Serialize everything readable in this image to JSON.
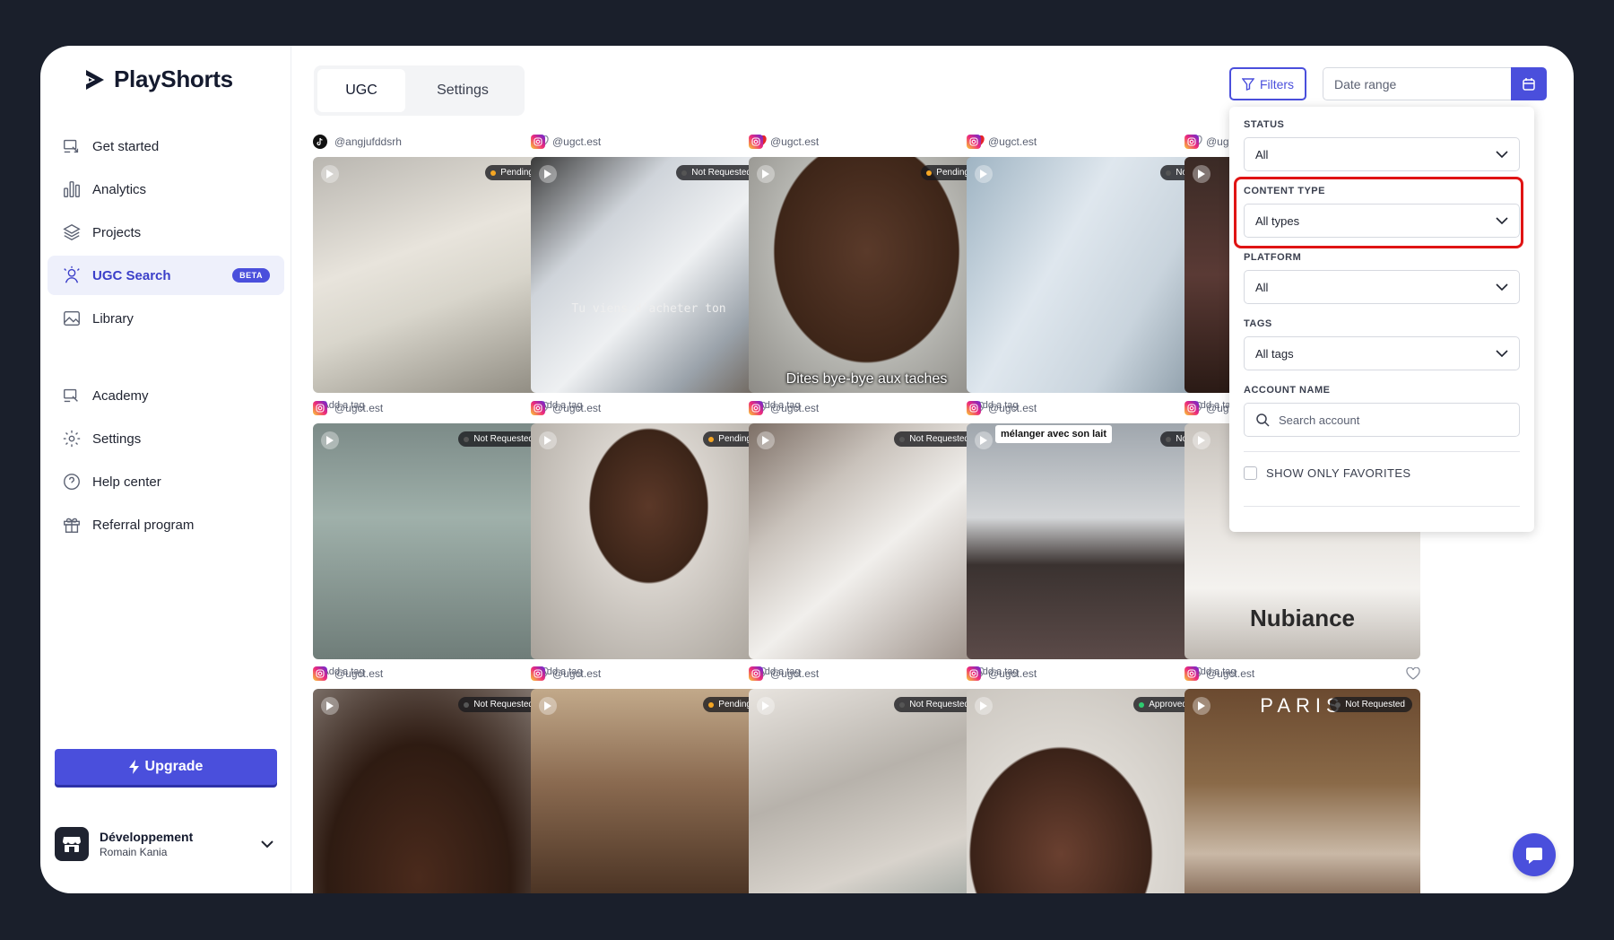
{
  "app": {
    "name": "PlayShorts"
  },
  "sidebar": {
    "items": [
      {
        "label": "Get started",
        "icon": "rocket-icon"
      },
      {
        "label": "Analytics",
        "icon": "bar-chart-icon"
      },
      {
        "label": "Projects",
        "icon": "layers-icon"
      },
      {
        "label": "UGC Search",
        "icon": "ugc-search-icon",
        "active": true,
        "badge": "BETA"
      },
      {
        "label": "Library",
        "icon": "image-icon"
      },
      {
        "label": "Academy",
        "icon": "academy-icon"
      },
      {
        "label": "Settings",
        "icon": "gear-icon"
      },
      {
        "label": "Help center",
        "icon": "help-circle-icon"
      },
      {
        "label": "Referral program",
        "icon": "gift-icon"
      }
    ],
    "upgrade_label": "Upgrade",
    "account": {
      "workspace": "Développement",
      "user": "Romain Kania"
    }
  },
  "tabs": [
    {
      "label": "UGC",
      "active": true
    },
    {
      "label": "Settings",
      "active": false
    }
  ],
  "toolbar": {
    "filters_label": "Filters",
    "date_range_placeholder": "Date range"
  },
  "filters": {
    "status": {
      "label": "STATUS",
      "value": "All"
    },
    "content_type": {
      "label": "CONTENT TYPE",
      "value": "All types"
    },
    "platform": {
      "label": "PLATFORM",
      "value": "All"
    },
    "tags": {
      "label": "TAGS",
      "value": "All tags"
    },
    "account_name": {
      "label": "ACCOUNT NAME",
      "placeholder": "Search account"
    },
    "favorites_label": "SHOW ONLY FAVORITES"
  },
  "add_tag_label": "Add a tag",
  "colors": {
    "accent": "#4a4fdc",
    "pending": "#f5a623",
    "not_requested": "#555555",
    "approved": "#2ecc71",
    "favorite": "#e5252a",
    "highlight": "#e01414"
  },
  "cards": [
    {
      "platform": "tiktok",
      "handle": "@angjufddsrh",
      "status": "Pending",
      "favorite": false,
      "bg": "bottle",
      "caption": ""
    },
    {
      "platform": "instagram",
      "handle": "@ugct.est",
      "status": "Not Requested",
      "favorite": true,
      "bg": "serum",
      "caption_mid": "Tu viens d'acheter ton"
    },
    {
      "platform": "instagram",
      "handle": "@ugct.est",
      "status": "Pending",
      "favorite": true,
      "bg": "face",
      "caption": "Dites bye-bye aux taches"
    },
    {
      "platform": "instagram",
      "handle": "@ugct.est",
      "status": "No",
      "favorite": false,
      "bg": "serum2"
    },
    {
      "platform": "instagram",
      "handle": "@ugct.est",
      "status": "",
      "favorite": false,
      "bg": "dark"
    },
    {
      "platform": "instagram",
      "handle": "@ugct.est",
      "status": "Not Requested",
      "favorite": false,
      "bg": "green"
    },
    {
      "platform": "instagram",
      "handle": "@ugct.est",
      "status": "Pending",
      "favorite": false,
      "bg": "face2"
    },
    {
      "platform": "instagram",
      "handle": "@ugct.est",
      "status": "Not Requested",
      "favorite": false,
      "bg": "lotion"
    },
    {
      "platform": "instagram",
      "handle": "@ugct.est",
      "status": "No",
      "favorite": false,
      "bg": "room",
      "note": "mélanger avec son lait"
    },
    {
      "platform": "instagram",
      "handle": "@ugct.est",
      "status": "",
      "favorite": false,
      "bg": "pump",
      "brand": "Nubiance"
    },
    {
      "platform": "instagram",
      "handle": "@ugct.est",
      "status": "Not Requested",
      "favorite": false,
      "bg": "face3"
    },
    {
      "platform": "instagram",
      "handle": "@ugct.est",
      "status": "Pending",
      "favorite": false,
      "bg": "face4"
    },
    {
      "platform": "instagram",
      "handle": "@ugct.est",
      "status": "Not Requested",
      "favorite": false,
      "bg": "fur"
    },
    {
      "platform": "instagram",
      "handle": "@ugct.est",
      "status": "Approved",
      "favorite": false,
      "bg": "face5"
    },
    {
      "platform": "instagram",
      "handle": "@ugct.est",
      "status": "Not Requested",
      "favorite": false,
      "bg": "wall",
      "brand": "PARIS"
    }
  ]
}
